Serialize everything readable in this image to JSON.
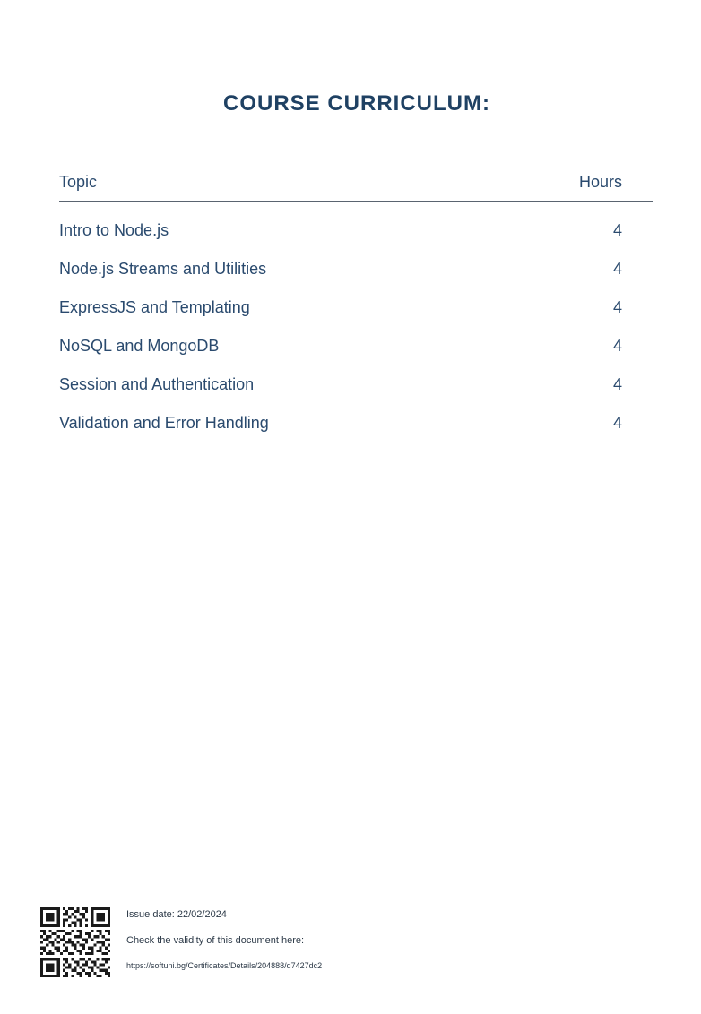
{
  "title": "COURSE CURRICULUM:",
  "table": {
    "headers": {
      "topic": "Topic",
      "hours": "Hours"
    },
    "rows": [
      {
        "topic": "Intro to Node.js",
        "hours": "4"
      },
      {
        "topic": "Node.js Streams and Utilities",
        "hours": "4"
      },
      {
        "topic": "ExpressJS and Templating",
        "hours": "4"
      },
      {
        "topic": "NoSQL and MongoDB",
        "hours": "4"
      },
      {
        "topic": "Session and Authentication",
        "hours": "4"
      },
      {
        "topic": "Validation and Error Handling",
        "hours": "4"
      }
    ]
  },
  "footer": {
    "issue_date": "Issue date: 22/02/2024",
    "check_text": "Check the validity of this document here:",
    "url": "https://softuni.bg/Certificates/Details/204888/d7427dc2",
    "qr_icon": "qr-code-icon"
  },
  "colors": {
    "title": "#1f4163",
    "text": "#2a4a6e",
    "rule": "#5a6470"
  }
}
